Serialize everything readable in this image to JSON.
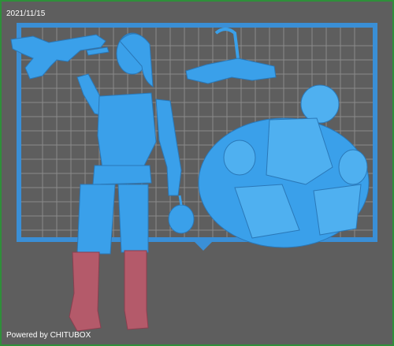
{
  "viewer": {
    "date_stamp": "2021/11/15",
    "powered_by": "Powered by CHITUBOX"
  },
  "scene": {
    "models": [
      {
        "name": "figure-woman-with-gun",
        "icon": "figure-model-icon"
      },
      {
        "name": "rifle-part",
        "icon": "rifle-model-icon"
      },
      {
        "name": "pistol-part",
        "icon": "pistol-model-icon"
      },
      {
        "name": "skull-base",
        "icon": "skull-base-model-icon"
      }
    ]
  },
  "colors": {
    "background": "#5e5e5e",
    "window_border": "#2f8f3a",
    "plate_frame": "#3a8fd6",
    "plate_grid": "#8f8f8f",
    "model_blue": "#3aa0ea",
    "boot_red": "#b45a6a",
    "text": "#ffffff"
  }
}
